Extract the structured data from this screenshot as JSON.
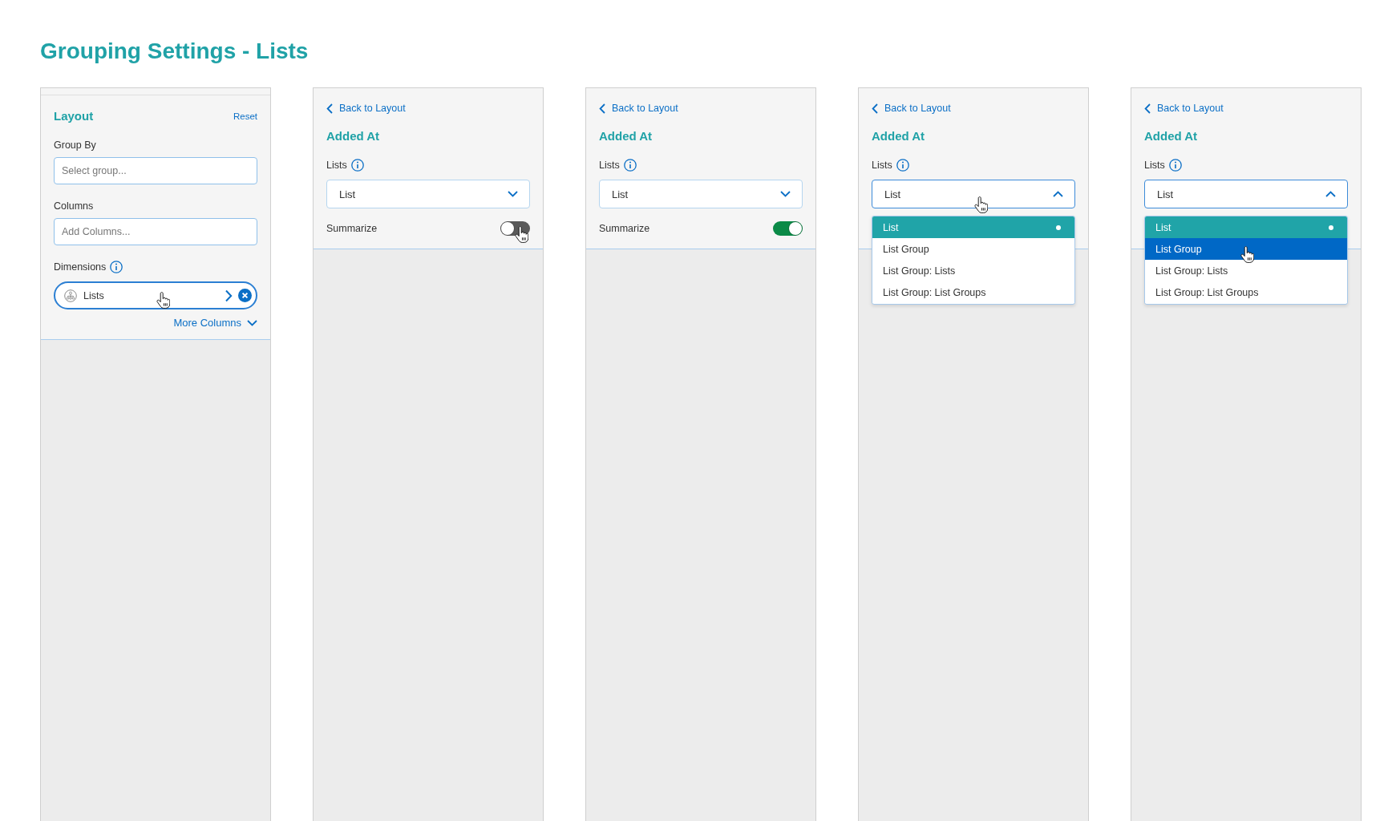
{
  "title": "Grouping Settings - Lists",
  "panels": [
    {
      "kind": "layout",
      "heading": "Layout",
      "reset": "Reset",
      "fields": [
        {
          "label": "Group By",
          "placeholder": "Select group..."
        },
        {
          "label": "Columns",
          "placeholder": "Add Columns..."
        }
      ],
      "dimensions": {
        "label": "Dimensions",
        "chip": {
          "label": "Lists",
          "hovered": true
        }
      },
      "more_columns": "More Columns"
    },
    {
      "kind": "detail",
      "back": "Back to Layout",
      "heading": "Added At",
      "select": {
        "label": "Lists",
        "value": "List",
        "open": false,
        "hovered": false
      },
      "summarize": {
        "label": "Summarize",
        "on": false,
        "hovered": true
      }
    },
    {
      "kind": "detail",
      "back": "Back to Layout",
      "heading": "Added At",
      "select": {
        "label": "Lists",
        "value": "List",
        "open": false,
        "hovered": false
      },
      "summarize": {
        "label": "Summarize",
        "on": true,
        "hovered": false
      }
    },
    {
      "kind": "detail",
      "back": "Back to Layout",
      "heading": "Added At",
      "select": {
        "label": "Lists",
        "value": "List",
        "open": true,
        "hovered": true,
        "options": [
          {
            "label": "List",
            "selected": true,
            "hovered": false
          },
          {
            "label": "List Group",
            "selected": false,
            "hovered": false
          },
          {
            "label": "List Group: Lists",
            "selected": false,
            "hovered": false
          },
          {
            "label": "List Group: List Groups",
            "selected": false,
            "hovered": false
          }
        ]
      }
    },
    {
      "kind": "detail",
      "back": "Back to Layout",
      "heading": "Added At",
      "select": {
        "label": "Lists",
        "value": "List",
        "open": true,
        "hovered": false,
        "options": [
          {
            "label": "List",
            "selected": true,
            "hovered": false
          },
          {
            "label": "List Group",
            "selected": false,
            "hovered": true
          },
          {
            "label": "List Group: Lists",
            "selected": false,
            "hovered": false
          },
          {
            "label": "List Group: List Groups",
            "selected": false,
            "hovered": false
          }
        ]
      }
    }
  ]
}
